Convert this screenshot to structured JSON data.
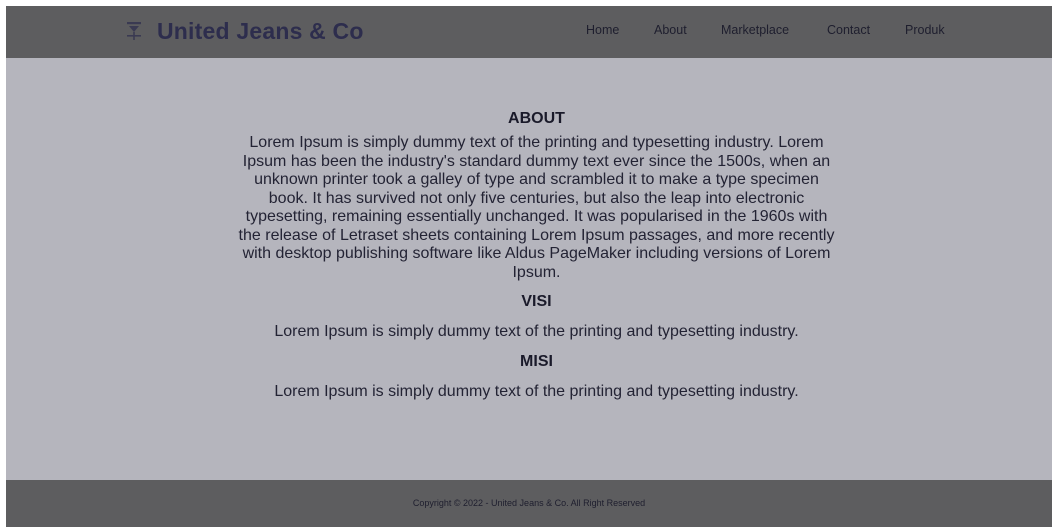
{
  "header": {
    "brand_icon": "jeans-hanger-icon",
    "brand_name": "United Jeans & Co",
    "nav": {
      "home": "Home",
      "about": "About",
      "marketplace": "Marketplace",
      "contact": "Contact",
      "produk": "Produk"
    }
  },
  "main": {
    "about": {
      "heading": "ABOUT",
      "text": "Lorem Ipsum is simply dummy text of the printing and typesetting industry. Lorem Ipsum has been the industry's standard dummy text ever since the 1500s, when an unknown printer took a galley of type and scrambled it to make a type specimen book. It has survived not only five centuries, but also the leap into electronic typesetting, remaining essentially unchanged. It was popularised in the 1960s with the release of Letraset sheets containing Lorem Ipsum passages, and more recently with desktop publishing software like Aldus PageMaker including versions of Lorem Ipsum."
    },
    "visi": {
      "heading": "VISI",
      "text": "Lorem Ipsum is simply dummy text of the printing and typesetting industry."
    },
    "misi": {
      "heading": "MISI",
      "text": "Lorem Ipsum is simply dummy text of the printing and typesetting industry."
    }
  },
  "footer": {
    "copyright": "Copyright © 2022 - United Jeans & Co. All Right Reserved"
  },
  "colors": {
    "page_background": "#b5b5bd",
    "bar_background": "#5d5d5f",
    "brand_text": "#2d2d4d",
    "body_text": "#232334"
  }
}
